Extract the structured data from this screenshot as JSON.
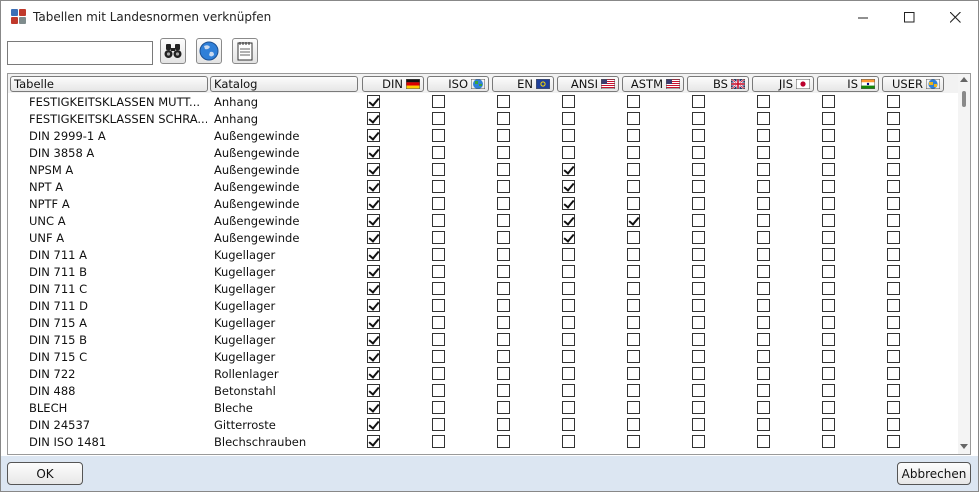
{
  "window": {
    "title": "Tabellen mit Landesnormen verknüpfen"
  },
  "window_controls": [
    {
      "name": "minimize-button",
      "icon": "minimize-icon"
    },
    {
      "name": "maximize-button",
      "icon": "maximize-icon"
    },
    {
      "name": "close-button",
      "icon": "close-icon"
    }
  ],
  "toolbar": {
    "search_value": "",
    "buttons": [
      {
        "name": "find-button",
        "icon": "binoculars-icon"
      },
      {
        "name": "globe-button",
        "icon": "globe-icon"
      },
      {
        "name": "notes-button",
        "icon": "notepad-icon"
      }
    ]
  },
  "columns": {
    "tabelle": "Tabelle",
    "katalog": "Katalog",
    "norms": [
      {
        "key": "din",
        "label": "DIN",
        "icon": "germany-flag-icon"
      },
      {
        "key": "iso",
        "label": "ISO",
        "icon": "globe-icon"
      },
      {
        "key": "en",
        "label": "EN",
        "icon": "eu-flag-icon"
      },
      {
        "key": "ansi",
        "label": "ANSI",
        "icon": "usa-flag-icon"
      },
      {
        "key": "astm",
        "label": "ASTM",
        "icon": "usa-flag-icon"
      },
      {
        "key": "bs",
        "label": "BS",
        "icon": "uk-flag-icon"
      },
      {
        "key": "jis",
        "label": "JIS",
        "icon": "japan-flag-icon"
      },
      {
        "key": "is",
        "label": "IS",
        "icon": "india-flag-icon"
      },
      {
        "key": "user",
        "label": "USER",
        "icon": "user-globe-icon"
      }
    ]
  },
  "rows": [
    {
      "tabelle": "FESTIGKEITSKLASSEN MUTT...",
      "katalog": "Anhang",
      "checks": [
        1,
        0,
        0,
        0,
        0,
        0,
        0,
        0,
        0
      ]
    },
    {
      "tabelle": "FESTIGKEITSKLASSEN SCHRA...",
      "katalog": "Anhang",
      "checks": [
        1,
        0,
        0,
        0,
        0,
        0,
        0,
        0,
        0
      ]
    },
    {
      "tabelle": "DIN 2999-1 A",
      "katalog": "Außengewinde",
      "checks": [
        1,
        0,
        0,
        0,
        0,
        0,
        0,
        0,
        0
      ]
    },
    {
      "tabelle": "DIN 3858 A",
      "katalog": "Außengewinde",
      "checks": [
        1,
        0,
        0,
        0,
        0,
        0,
        0,
        0,
        0
      ]
    },
    {
      "tabelle": "NPSM A",
      "katalog": "Außengewinde",
      "checks": [
        1,
        0,
        0,
        1,
        0,
        0,
        0,
        0,
        0
      ]
    },
    {
      "tabelle": "NPT A",
      "katalog": "Außengewinde",
      "checks": [
        1,
        0,
        0,
        1,
        0,
        0,
        0,
        0,
        0
      ]
    },
    {
      "tabelle": "NPTF A",
      "katalog": "Außengewinde",
      "checks": [
        1,
        0,
        0,
        1,
        0,
        0,
        0,
        0,
        0
      ]
    },
    {
      "tabelle": "UNC A",
      "katalog": "Außengewinde",
      "checks": [
        1,
        0,
        0,
        1,
        1,
        0,
        0,
        0,
        0
      ]
    },
    {
      "tabelle": "UNF A",
      "katalog": "Außengewinde",
      "checks": [
        1,
        0,
        0,
        1,
        0,
        0,
        0,
        0,
        0
      ]
    },
    {
      "tabelle": "DIN 711 A",
      "katalog": "Kugellager",
      "checks": [
        1,
        0,
        0,
        0,
        0,
        0,
        0,
        0,
        0
      ]
    },
    {
      "tabelle": "DIN 711 B",
      "katalog": "Kugellager",
      "checks": [
        1,
        0,
        0,
        0,
        0,
        0,
        0,
        0,
        0
      ]
    },
    {
      "tabelle": "DIN 711 C",
      "katalog": "Kugellager",
      "checks": [
        1,
        0,
        0,
        0,
        0,
        0,
        0,
        0,
        0
      ]
    },
    {
      "tabelle": "DIN 711 D",
      "katalog": "Kugellager",
      "checks": [
        1,
        0,
        0,
        0,
        0,
        0,
        0,
        0,
        0
      ]
    },
    {
      "tabelle": "DIN 715 A",
      "katalog": "Kugellager",
      "checks": [
        1,
        0,
        0,
        0,
        0,
        0,
        0,
        0,
        0
      ]
    },
    {
      "tabelle": "DIN 715 B",
      "katalog": "Kugellager",
      "checks": [
        1,
        0,
        0,
        0,
        0,
        0,
        0,
        0,
        0
      ]
    },
    {
      "tabelle": "DIN 715 C",
      "katalog": "Kugellager",
      "checks": [
        1,
        0,
        0,
        0,
        0,
        0,
        0,
        0,
        0
      ]
    },
    {
      "tabelle": "DIN 722",
      "katalog": "Rollenlager",
      "checks": [
        1,
        0,
        0,
        0,
        0,
        0,
        0,
        0,
        0
      ]
    },
    {
      "tabelle": "DIN 488",
      "katalog": "Betonstahl",
      "checks": [
        1,
        0,
        0,
        0,
        0,
        0,
        0,
        0,
        0
      ]
    },
    {
      "tabelle": "BLECH",
      "katalog": "Bleche",
      "checks": [
        1,
        0,
        0,
        0,
        0,
        0,
        0,
        0,
        0
      ]
    },
    {
      "tabelle": "DIN 24537",
      "katalog": "Gitterroste",
      "checks": [
        1,
        0,
        0,
        0,
        0,
        0,
        0,
        0,
        0
      ]
    },
    {
      "tabelle": "DIN ISO 1481",
      "katalog": "Blechschrauben",
      "checks": [
        1,
        0,
        0,
        0,
        0,
        0,
        0,
        0,
        0
      ]
    }
  ],
  "footer": {
    "ok": "OK",
    "cancel": "Abbrechen"
  }
}
